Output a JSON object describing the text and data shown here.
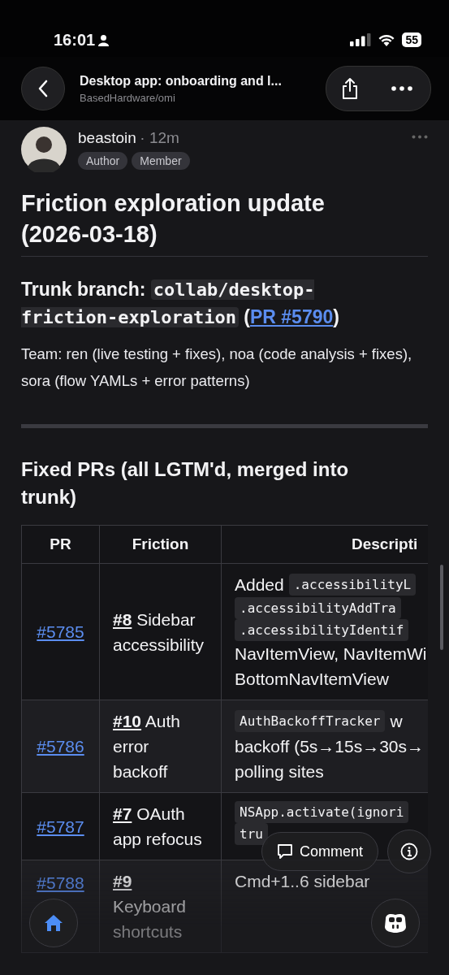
{
  "status_bar": {
    "time": "16:01",
    "battery": "55"
  },
  "nav": {
    "title": "Desktop app: onboarding and l...",
    "subtitle": "BasedHardware/omi"
  },
  "comment": {
    "author": "beastoin",
    "age": "· 12m",
    "badges": [
      "Author",
      "Member"
    ]
  },
  "heading": "Friction exploration update (2026-03-18)",
  "trunk": {
    "label": "Trunk branch:",
    "branch": "collab/desktop-friction-exploration",
    "open": "(",
    "link": "PR #5790",
    "close": ")"
  },
  "team": "Team: ren (live testing + fixes), noa (code analysis + fixes), sora (flow YAMLs + error patterns)",
  "section_title": "Fixed PRs (all LGTM'd, merged into trunk)",
  "table": {
    "columns": [
      "PR",
      "Friction",
      "Descripti"
    ],
    "rows": [
      {
        "pr": "#5785",
        "issue": "#8",
        "friction": "Sidebar accessibility",
        "description": [
          [
            {
              "kind": "text",
              "text": "Added"
            },
            {
              "kind": "code",
              "text": ".accessibilityL"
            }
          ],
          [
            {
              "kind": "code",
              "text": ".accessibilityAddTra"
            }
          ],
          [
            {
              "kind": "code",
              "text": ".accessibilityIdentif"
            }
          ],
          [
            {
              "kind": "text",
              "text": "NavItemView, NavItemWi"
            }
          ],
          [
            {
              "kind": "text",
              "text": "BottomNavItemView"
            }
          ]
        ]
      },
      {
        "pr": "#5786",
        "issue": "#10",
        "friction": "Auth error backoff",
        "description": [
          [
            {
              "kind": "code",
              "text": "AuthBackoffTracker"
            },
            {
              "kind": "text",
              "text": "w"
            }
          ],
          [
            {
              "kind": "text",
              "text": "backoff (5s→15s→30s→"
            }
          ],
          [
            {
              "kind": "text",
              "text": "polling sites"
            }
          ]
        ]
      },
      {
        "pr": "#5787",
        "issue": "#7",
        "friction": "OAuth app refocus",
        "description": [
          [
            {
              "kind": "code",
              "text": "NSApp.activate(ignori"
            }
          ],
          [
            {
              "kind": "code",
              "text": "tru"
            }
          ]
        ]
      },
      {
        "pr": "#5788",
        "issue": "#9",
        "friction": "Keyboard shortcuts",
        "description": [
          [
            {
              "kind": "text",
              "text": "Cmd+1..6 sidebar"
            }
          ]
        ]
      }
    ]
  },
  "actions": {
    "comment_button": "Comment"
  }
}
